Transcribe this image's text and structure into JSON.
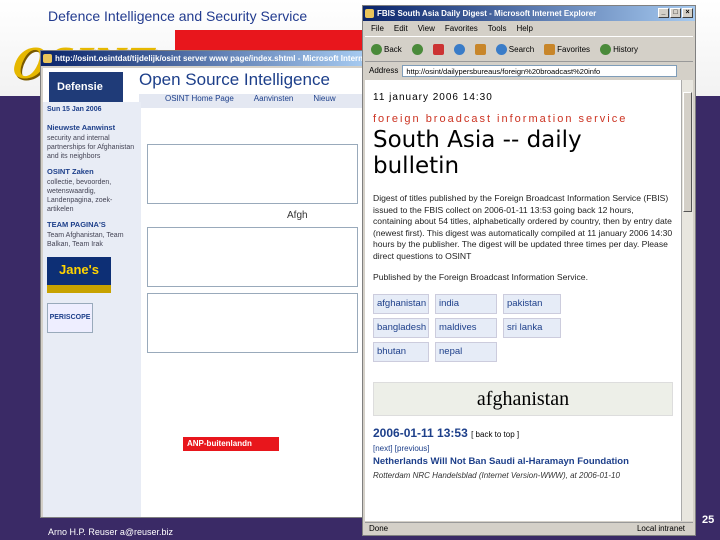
{
  "slide": {
    "title": "Defence Intelligence and Security Service",
    "author": "Arno H.P. Reuser a@reuser.biz",
    "page_number": "25",
    "logo_text": "OSINT"
  },
  "back_window": {
    "title": "http://osint.osintdat/tijdelijk/osint server www page/index.shtml - Microsoft Internet Explorer",
    "logo": "Defensie",
    "heading": "Open Source Intelligence",
    "nav": [
      "OSINT Home Page",
      "Aanvinsten",
      "Nieuw"
    ],
    "date": "Sun 15 Jan 2006",
    "sidebar_sections": [
      {
        "heading": "Nieuwste Aanwinst",
        "text": "security and internal partnerships for Afghanistan and its neighbors"
      },
      {
        "heading": "OSINT Zaken",
        "text": "collectie, bevoorden, wetenswaardig, Landenpagina, zoek-artikelen"
      },
      {
        "heading": "TEAM PAGINA'S",
        "text": "Team Afghanistan, Team Balkan, Team Irak"
      }
    ],
    "janes_logo": "Jane's",
    "periscope_logo": "PERISCOPE",
    "afghanistan_heading": "Afgh",
    "anp_banner": "ANP-buitenlandn"
  },
  "front_window": {
    "title": "FBIS South Asia Daily Digest - Microsoft Internet Explorer",
    "menu": [
      "File",
      "Edit",
      "View",
      "Favorites",
      "Tools",
      "Help"
    ],
    "toolbar": {
      "back": "Back",
      "search": "Search",
      "favorites": "Favorites",
      "history": "History"
    },
    "address_label": "Address",
    "address_value": "http://osint/dailypersbureaus/foreign%20broadcast%20info",
    "status": "Done",
    "status_zone": "Local intranet",
    "content": {
      "date": "11 january 2006 14:30",
      "service": "foreign broadcast information service",
      "headline": "South Asia -- daily bulletin",
      "description": "Digest of titles published by the Foreign Broadcast Information Service (FBIS) issued to the FBIS collect on 2006-01-11 13:53 going back 12 hours, containing about 54 titles, alphabetically ordered by country, then by entry date (newest first). This digest was automatically compiled at 11 january 2006 14:30 hours by the publisher. The digest will be updated three times per day. Please direct questions to OSINT",
      "published_by": "Published by the Foreign Broadcast Information Service.",
      "countries": [
        "afghanistan",
        "india",
        "pakistan",
        "bangladesh",
        "maldives",
        "sri lanka",
        "bhutan",
        "nepal"
      ],
      "country_section": "afghanistan",
      "timestamp": "2006-01-11 13:53",
      "back_to_top": "[ back to top ]",
      "next_prev": "[next] [previous]",
      "article_title": "Netherlands Will Not Ban Saudi al-Haramayn Foundation",
      "article_source": "Rotterdam NRC Handelsblad (Internet Version-WWW), at 2006-01-10"
    }
  }
}
